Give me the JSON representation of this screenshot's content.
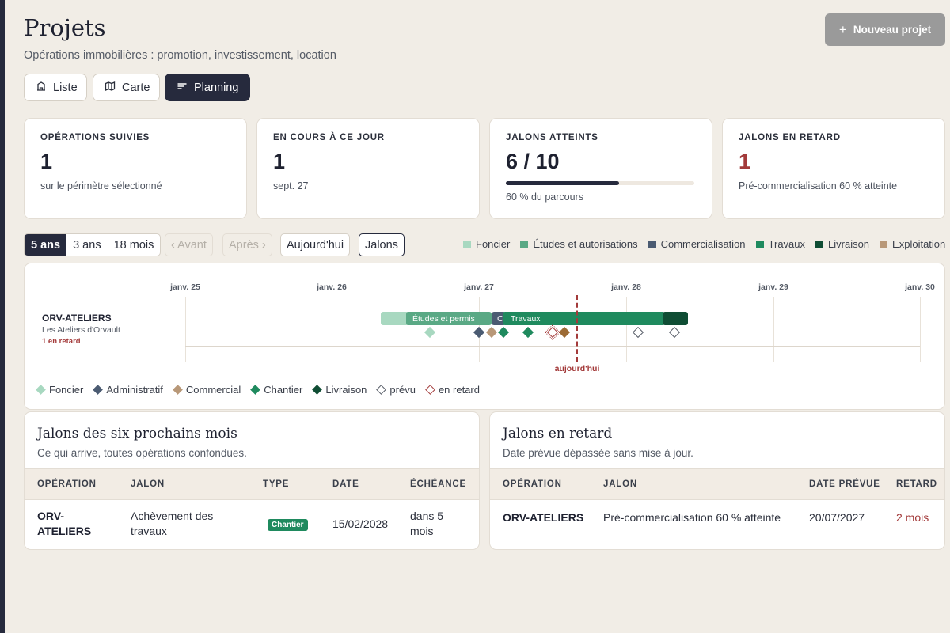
{
  "header": {
    "title": "Projets",
    "subtitle": "Opérations immobilières : promotion, investissement, location",
    "new_project_label": "Nouveau projet"
  },
  "view_tabs": [
    {
      "label": "Liste",
      "icon": "building-icon",
      "active": false
    },
    {
      "label": "Carte",
      "icon": "map-icon",
      "active": false
    },
    {
      "label": "Planning",
      "icon": "bars-icon",
      "active": true
    }
  ],
  "kpis": [
    {
      "label": "OPÉRATIONS SUIVIES",
      "value": "1",
      "note": "sur le périmètre sélectionné"
    },
    {
      "label": "EN COURS À CE JOUR",
      "value": "1",
      "note": "sept. 27"
    },
    {
      "label": "JALONS ATTEINTS",
      "value": "6 / 10",
      "note": "60 % du parcours",
      "progress": 0.6
    },
    {
      "label": "JALONS EN RETARD",
      "value": "1",
      "note": "Pré-commercialisation 60 % atteinte"
    }
  ],
  "controls": {
    "ranges": [
      "5 ans",
      "3 ans",
      "18 mois"
    ],
    "active_range": "5 ans",
    "prev": "‹ Avant",
    "next": "Après ›",
    "today": "Aujourd'hui",
    "milestones": "Jalons"
  },
  "phase_legend": [
    {
      "label": "Foncier",
      "color": "#a8d8c0"
    },
    {
      "label": "Études et autorisations",
      "color": "#5aa985"
    },
    {
      "label": "Commercialisation",
      "color": "#4b5b72"
    },
    {
      "label": "Travaux",
      "color": "#1f8a5e"
    },
    {
      "label": "Livraison",
      "color": "#0f4d34"
    },
    {
      "label": "Exploitation",
      "color": "#b89878"
    }
  ],
  "timeline": {
    "ticks": [
      "janv. 25",
      "janv. 26",
      "janv. 27",
      "janv. 28",
      "janv. 29",
      "janv. 30"
    ],
    "today_label": "aujourd'hui",
    "operation": {
      "code": "ORV-ATELIERS",
      "name": "Les Ateliers d'Orvault",
      "late": "1 en retard"
    },
    "bar_labels": {
      "etudes": "Études et permis",
      "commercialisation": "C",
      "travaux": "Travaux"
    }
  },
  "milestone_legend": [
    {
      "label": "Foncier",
      "color": "#a8d8c0"
    },
    {
      "label": "Administratif",
      "color": "#4b5b72"
    },
    {
      "label": "Commercial",
      "color": "#b89878"
    },
    {
      "label": "Chantier",
      "color": "#1f8a5e"
    },
    {
      "label": "Livraison",
      "color": "#0f4d34"
    },
    {
      "label": "prévu",
      "style": "hollow"
    },
    {
      "label": "en retard",
      "style": "hollow-red"
    }
  ],
  "upcoming": {
    "title": "Jalons des six prochains mois",
    "subtitle": "Ce qui arrive, toutes opérations confondues.",
    "columns": [
      "OPÉRATION",
      "JALON",
      "TYPE",
      "DATE",
      "ÉCHÉANCE"
    ],
    "rows": [
      {
        "operation": "ORV-ATELIERS",
        "milestone": "Achèvement des travaux",
        "type": "Chantier",
        "date": "15/02/2028",
        "due": "dans 5 mois"
      }
    ]
  },
  "late": {
    "title": "Jalons en retard",
    "subtitle": "Date prévue dépassée sans mise à jour.",
    "columns": [
      "OPÉRATION",
      "JALON",
      "DATE PRÉVUE",
      "RETARD"
    ],
    "rows": [
      {
        "operation": "ORV-ATELIERS",
        "milestone": "Pré-commercialisation 60 % atteinte",
        "planned_date": "20/07/2027",
        "delay": "2 mois"
      }
    ]
  }
}
